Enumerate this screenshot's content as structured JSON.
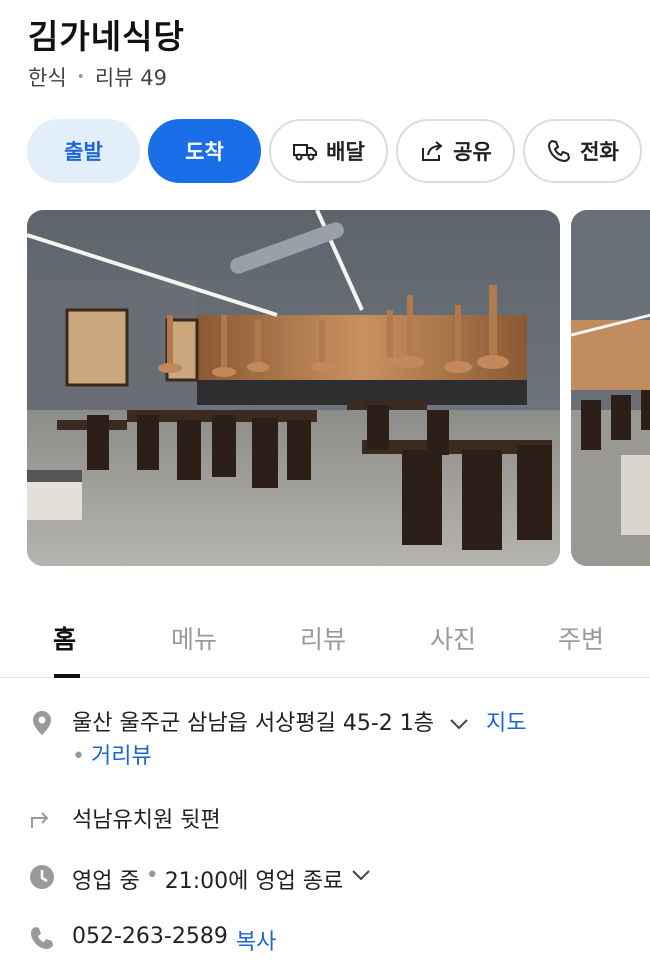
{
  "header": {
    "name": "김가네식당",
    "category": "한식",
    "separator": "•",
    "reviews": "리뷰 49"
  },
  "actions": {
    "depart": "출발",
    "arrive": "도착",
    "delivery": "배달",
    "share": "공유",
    "call": "전화"
  },
  "tabs": [
    "홈",
    "메뉴",
    "리뷰",
    "사진",
    "주변"
  ],
  "info": {
    "address": "울산 울주군 삼남읍 서상평길 45-2 1층",
    "map_link": "지도",
    "street_view_link": "거리뷰",
    "directions_note": "석남유치원 뒷편",
    "hours_status": "영업 중",
    "hours_detail": "21:00에 영업 종료",
    "phone": "052-263-2589",
    "copy_link": "복사"
  },
  "colors": {
    "accent": "#1a6fe8",
    "accent_light": "#e3eefb",
    "link": "#1a66d6",
    "icon_gray": "#9a9a9a"
  },
  "icons": {
    "delivery": "delivery-truck-icon",
    "share": "share-icon",
    "call": "phone-icon",
    "address": "location-pin-icon",
    "directions": "turn-arrow-icon",
    "hours": "clock-icon",
    "phone": "phone-icon"
  }
}
